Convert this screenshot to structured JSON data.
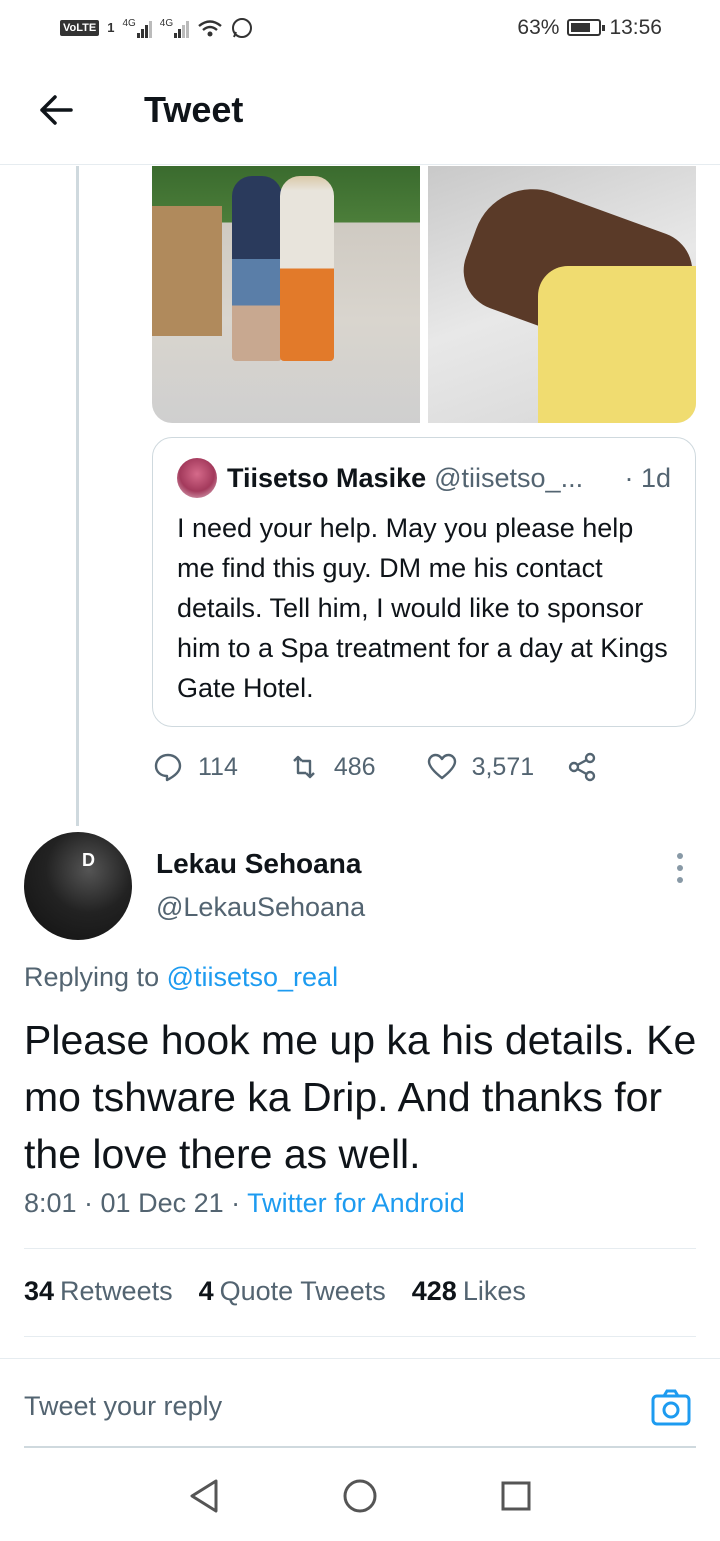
{
  "status_bar": {
    "network_label": "VoLTE",
    "sim": "1",
    "signal_1": "4G",
    "signal_2": "4G",
    "battery": "63%",
    "time": "13:56"
  },
  "header": {
    "title": "Tweet"
  },
  "quoted_tweet": {
    "name": "Tiisetso Masike",
    "handle": "@tiisetso_...",
    "time": "· 1d",
    "text": "I need your help. May you please help me find this guy. DM me his contact details. Tell him, I would like to sponsor him to a Spa treatment for a day at Kings Gate Hotel.",
    "replies": "114",
    "retweets": "486",
    "likes": "3,571"
  },
  "tweet": {
    "name": "Lekau Sehoana",
    "handle": "@LekauSehoana",
    "avatar_text": "D",
    "replying_prefix": "Replying to ",
    "replying_to": "@tiisetso_real",
    "text": "Please hook me up ka his details. Ke mo tshware ka Drip. And thanks for the love there as well.",
    "time": "8:01 · 01 Dec 21 · ",
    "source": "Twitter for Android",
    "stats": {
      "retweets_count": "34",
      "retweets_label": "Retweets",
      "quotes_count": "4",
      "quotes_label": "Quote Tweets",
      "likes_count": "428",
      "likes_label": "Likes"
    }
  },
  "reply_bar": {
    "placeholder": "Tweet your reply"
  },
  "colors": {
    "accent": "#1d9bf0",
    "text": "#0f1419",
    "secondary": "#536471",
    "border": "#e6ecf0"
  }
}
